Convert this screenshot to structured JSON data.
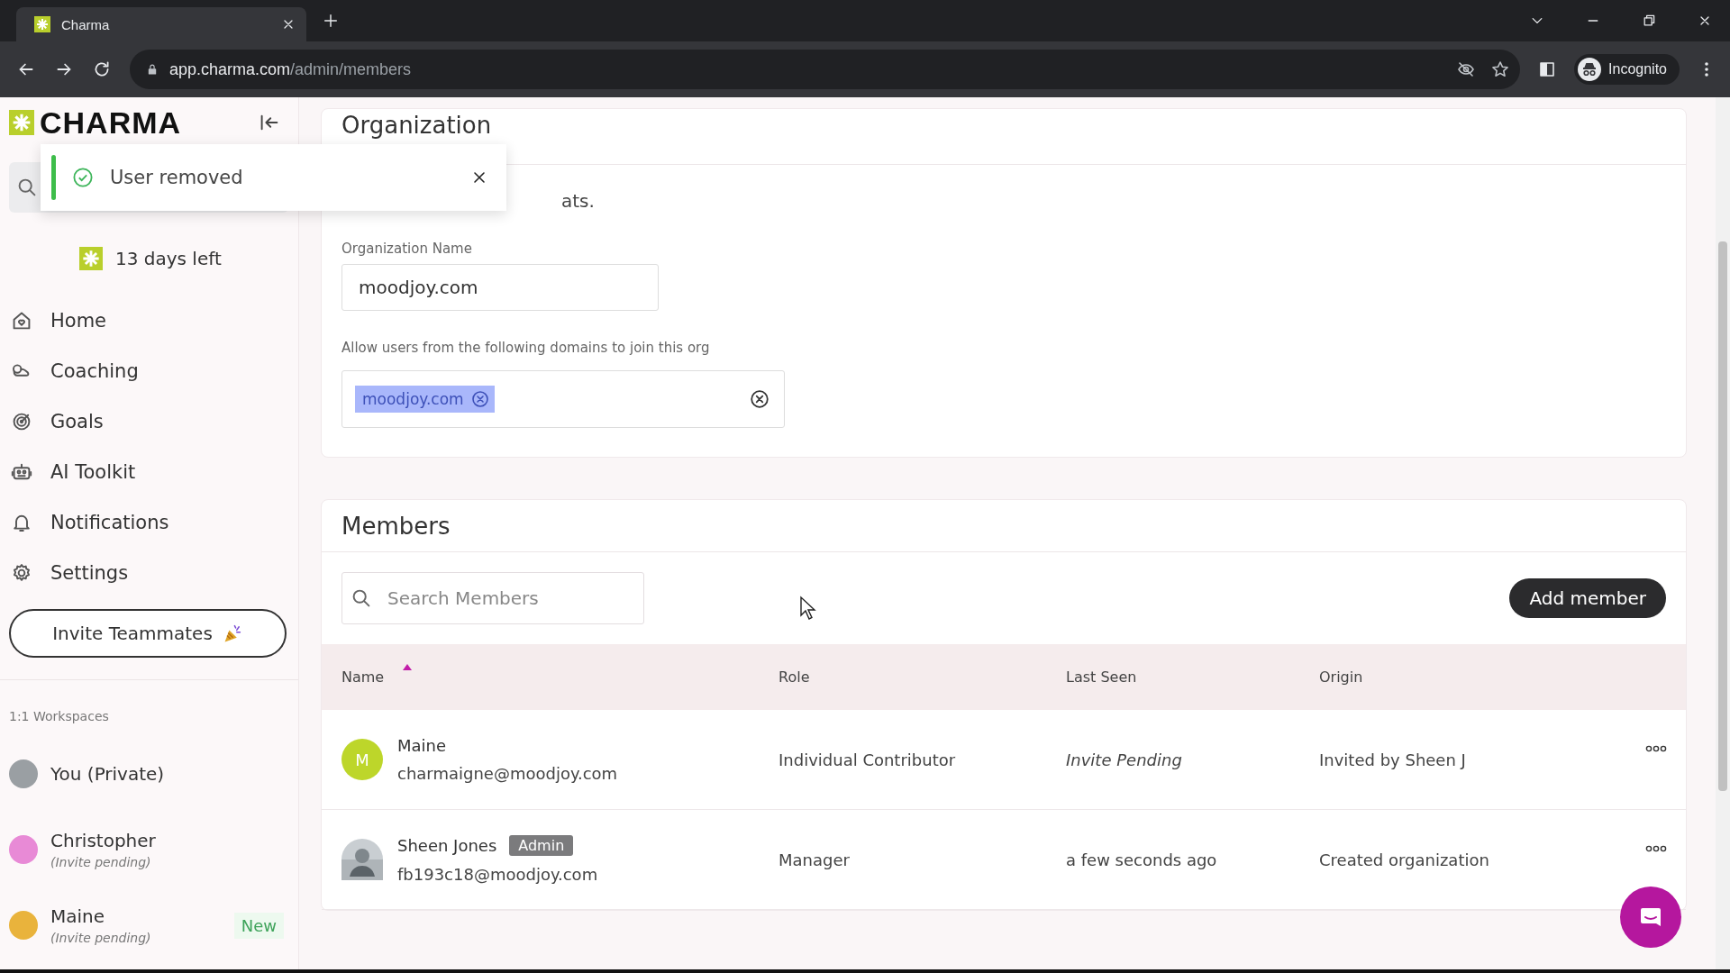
{
  "browser": {
    "tab": {
      "title": "Charma"
    },
    "url": {
      "host": "app.charma.com",
      "path": "/admin/members"
    },
    "profile": "Incognito"
  },
  "toast": {
    "message": "User removed"
  },
  "sidebar": {
    "logo": "CHARMA",
    "trial": "13 days left",
    "nav": [
      {
        "label": "Home"
      },
      {
        "label": "Coaching"
      },
      {
        "label": "Goals"
      },
      {
        "label": "AI Toolkit"
      },
      {
        "label": "Notifications"
      },
      {
        "label": "Settings"
      }
    ],
    "invite_button": "Invite Teammates",
    "workspaces_heading": "1:1 Workspaces",
    "workspaces": [
      {
        "name": "You (Private)",
        "color": "#9a9fa3"
      },
      {
        "name": "Christopher",
        "note": "(Invite pending)",
        "color": "#e88ad6"
      },
      {
        "name": "Maine",
        "note": "(Invite pending)",
        "badge": "New",
        "color": "#e9b33c"
      }
    ]
  },
  "organization": {
    "title": "Organization",
    "description": "ats.",
    "name_label": "Organization Name",
    "name_value": "moodjoy.com",
    "domains_label": "Allow users from the following domains to join this org",
    "domains": [
      "moodjoy.com"
    ]
  },
  "members": {
    "title": "Members",
    "search": {
      "placeholder": "Search Members"
    },
    "add_button": "Add member",
    "columns": [
      {
        "label": "Name",
        "sorted": true
      },
      {
        "label": "Role",
        "sorted": false
      },
      {
        "label": "Last Seen",
        "sorted": false
      },
      {
        "label": "Origin",
        "sorted": false
      }
    ],
    "rows": [
      {
        "name": "Maine",
        "email": "charmaigne@moodjoy.com",
        "avatar": {
          "kind": "letter",
          "text": "M"
        },
        "role": "Individual Contributor",
        "last_seen": "Invite Pending",
        "invite_pending": true,
        "origin": "Invited by Sheen J"
      },
      {
        "name": "Sheen Jones",
        "badge": "Admin",
        "email": "fb193c18@moodjoy.com",
        "role": "Manager",
        "last_seen": "a few seconds ago",
        "invite_pending": false,
        "origin": "Created organization"
      }
    ]
  }
}
